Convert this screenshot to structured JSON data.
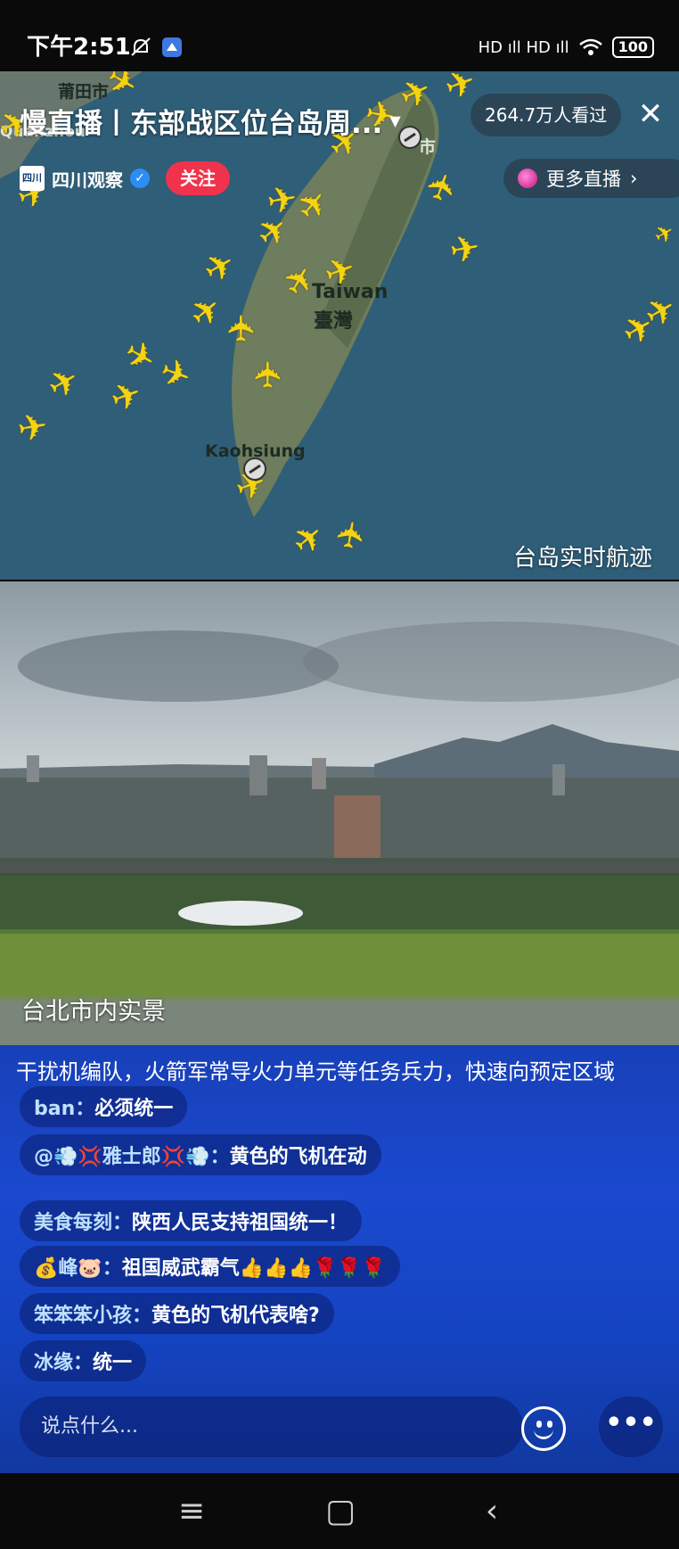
{
  "status_bar": {
    "time": "下午2:51",
    "network": "HD ıll HD ıll",
    "battery": "100"
  },
  "header": {
    "title": "慢直播丨东部战区位台岛周...",
    "viewers": "264.7万人看过",
    "channel_name": "四川观察",
    "channel_logo": "四川",
    "follow_label": "关注",
    "more_live_label": "更多直播"
  },
  "map": {
    "caption": "台岛实时航迹",
    "labels": {
      "putian": "莆田市",
      "quanzhou": "Quanzhou",
      "taiwan_en": "Taiwan",
      "taiwan_zh": "臺灣",
      "kaohsiung": "Kaohsiung",
      "city": "市"
    }
  },
  "video": {
    "caption": "台北市内实景"
  },
  "chat": {
    "ticker": "干扰机编队，火箭军常导火力单元等任务兵力，快速向预定区域",
    "messages": [
      {
        "user": "ban：",
        "text": "必须统一"
      },
      {
        "user": "@💨💢雅士郎💢💨：",
        "text": "黄色的飞机在动"
      },
      {
        "user": "美食每刻：",
        "text": "陕西人民支持祖国统一！"
      },
      {
        "user": "💰峰🐷：",
        "text": "祖国威武霸气👍👍👍🌹🌹🌹"
      },
      {
        "user": "笨笨笨小孩：",
        "text": "黄色的飞机代表啥?"
      },
      {
        "user": "冰缘：",
        "text": "统一"
      }
    ],
    "input_placeholder": "说点什么...",
    "more_label": "•••"
  },
  "nav": {
    "menu": "≡",
    "home": "▢",
    "back": "‹"
  },
  "colors": {
    "accent_follow": "#f0334d",
    "chat_bg": "#1b49cf",
    "plane": "#f4d312",
    "sea": "#2f5e78"
  }
}
